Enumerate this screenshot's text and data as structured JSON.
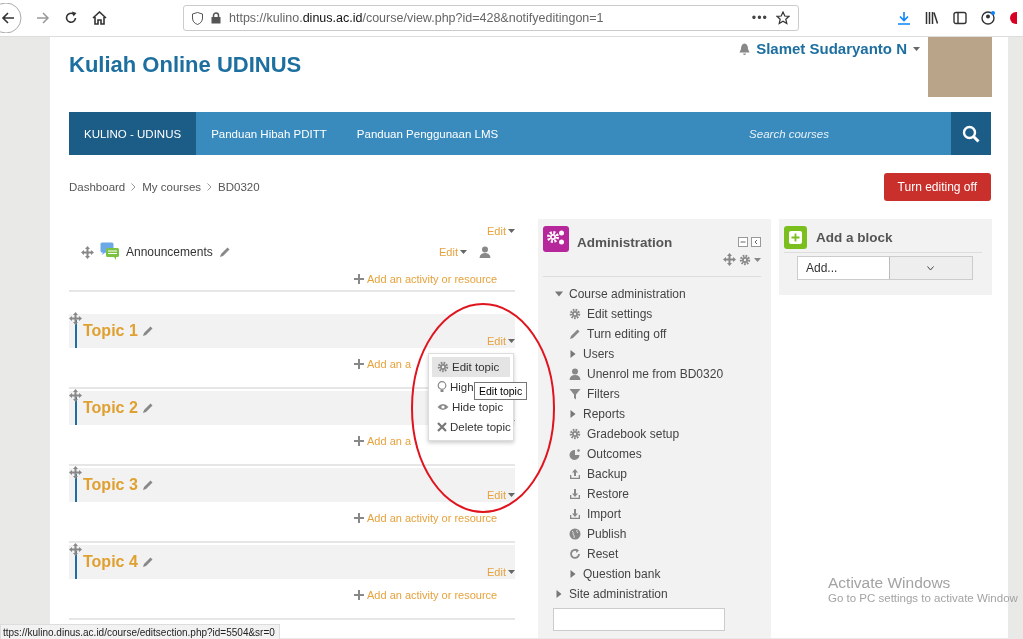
{
  "browser": {
    "url_host": "https://kulino.",
    "url_domain": "dinus.ac.id",
    "url_path": "/course/view.php?id=428&notifyeditingon=1",
    "more": "•••"
  },
  "header": {
    "site_title": "Kuliah Online UDINUS",
    "user_name": "Slamet Sudaryanto N"
  },
  "navbar": {
    "items": [
      {
        "label": "KULINO - UDINUS",
        "selected": true
      },
      {
        "label": "Panduan Hibah PDITT",
        "selected": false
      },
      {
        "label": "Panduan Penggunaan LMS",
        "selected": false
      }
    ],
    "search": {
      "placeholder": "Search courses"
    }
  },
  "breadcrumb": [
    "Dashboard",
    "My courses",
    "BD0320"
  ],
  "editing_button": "Turn editing off",
  "sections": [
    {
      "kind": "general",
      "edit": "Edit",
      "activities": [
        {
          "name": "Announcements",
          "edit": "Edit"
        }
      ],
      "add": "Add an activity or resource"
    },
    {
      "kind": "topic",
      "title": "Topic 1",
      "edit": "Edit",
      "add": "Add an a"
    },
    {
      "kind": "topic",
      "title": "Topic 2",
      "add": "Add an a"
    },
    {
      "kind": "topic",
      "title": "Topic 3",
      "edit": "Edit",
      "add": "Add an activity or resource"
    },
    {
      "kind": "topic",
      "title": "Topic 4",
      "edit": "Edit",
      "add": "Add an activity or resource"
    }
  ],
  "edit_menu": {
    "items": [
      {
        "label": "Edit topic",
        "selected": true
      },
      {
        "label": "High",
        "selected": false
      },
      {
        "label": "Hide topic",
        "selected": false
      },
      {
        "label": "Delete topic",
        "selected": false
      }
    ],
    "tooltip": "Edit topic"
  },
  "administration": {
    "title": "Administration",
    "tree": [
      {
        "kind": "branch",
        "label": "Course administration",
        "expanded": true,
        "children": [
          {
            "kind": "leaf",
            "label": "Edit settings"
          },
          {
            "kind": "leaf",
            "label": "Turn editing off"
          },
          {
            "kind": "branch",
            "label": "Users",
            "expanded": false
          },
          {
            "kind": "leaf",
            "label": "Unenrol me from BD0320"
          },
          {
            "kind": "leaf",
            "label": "Filters"
          },
          {
            "kind": "branch",
            "label": "Reports",
            "expanded": false
          },
          {
            "kind": "leaf",
            "label": "Gradebook setup"
          },
          {
            "kind": "leaf",
            "label": "Outcomes"
          },
          {
            "kind": "leaf",
            "label": "Backup"
          },
          {
            "kind": "leaf",
            "label": "Restore"
          },
          {
            "kind": "leaf",
            "label": "Import"
          },
          {
            "kind": "leaf",
            "label": "Publish"
          },
          {
            "kind": "leaf",
            "label": "Reset"
          },
          {
            "kind": "branch",
            "label": "Question bank",
            "expanded": false
          }
        ]
      },
      {
        "kind": "branch",
        "label": "Site administration",
        "expanded": false
      }
    ]
  },
  "add_block": {
    "title": "Add a block",
    "select": "Add..."
  },
  "status_url": "ttps://kulino.dinus.ac.id/course/editsection.php?id=5504&sr=0",
  "os_notice": {
    "title": "Activate Windows",
    "text": "Go to PC settings to activate Window"
  }
}
